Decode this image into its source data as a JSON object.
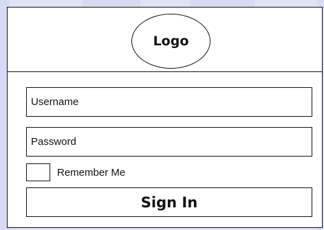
{
  "header": {
    "logo_text": "Logo"
  },
  "form": {
    "username": {
      "placeholder": "Username",
      "value": ""
    },
    "password": {
      "placeholder": "Password",
      "value": ""
    },
    "remember_me": {
      "label": "Remember Me",
      "checked": false
    },
    "sign_in_label": "Sign In"
  },
  "colors": {
    "background": "#dfe3f5",
    "frame": "#ffffff",
    "stroke": "#111111"
  }
}
